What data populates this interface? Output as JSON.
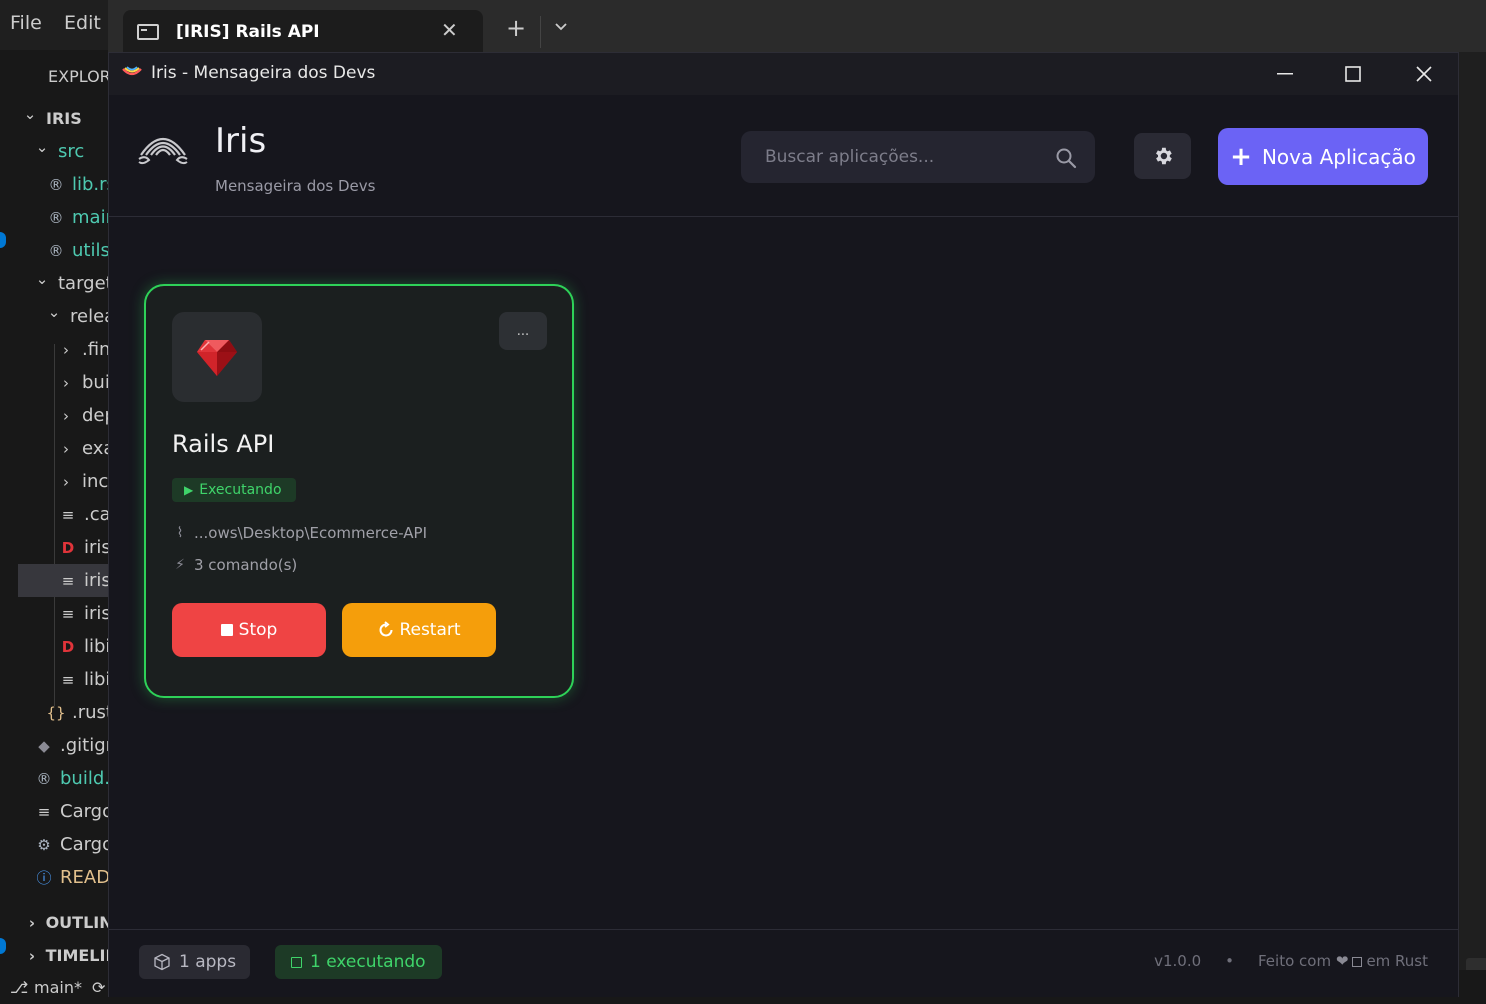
{
  "vscode": {
    "menu": [
      "File",
      "Edit"
    ],
    "explorer_title": "EXPLORER",
    "tree": [
      {
        "label": "IRIS",
        "chevron": "v",
        "indent": 0,
        "bold": true
      },
      {
        "label": "src",
        "chevron": "v",
        "indent": 1,
        "color": "#4ec9b0"
      },
      {
        "label": "lib.rs",
        "icon": "rust-icon",
        "indent": 2,
        "color": "#4ec9b0"
      },
      {
        "label": "main.rs",
        "icon": "rust-icon",
        "indent": 2,
        "color": "#4ec9b0"
      },
      {
        "label": "utils.rs",
        "icon": "rust-icon",
        "indent": 2,
        "color": "#4ec9b0"
      },
      {
        "label": "target",
        "chevron": "v",
        "indent": 1
      },
      {
        "label": "release",
        "chevron": "v",
        "indent": 2
      },
      {
        "label": ".fingerprint",
        "chevron": ">",
        "indent": 3
      },
      {
        "label": "build",
        "chevron": ">",
        "indent": 3
      },
      {
        "label": "deps",
        "chevron": ">",
        "indent": 3
      },
      {
        "label": "examples",
        "chevron": ">",
        "indent": 3
      },
      {
        "label": "incremental",
        "chevron": ">",
        "indent": 3
      },
      {
        "label": ".cargo-lock",
        "icon": "lines-icon",
        "indent": 3
      },
      {
        "label": "iris.d",
        "icon": "d-icon",
        "indent": 3
      },
      {
        "label": "iris.exe",
        "icon": "lines-icon",
        "indent": 3,
        "selected": true
      },
      {
        "label": "iris.pdb",
        "icon": "lines-icon",
        "indent": 3
      },
      {
        "label": "libiris.d",
        "icon": "d-icon",
        "indent": 3
      },
      {
        "label": "libiris.rlib",
        "icon": "lines-icon",
        "indent": 3
      },
      {
        "label": ".rustc_info.json",
        "icon": "braces-icon",
        "indent": 2
      },
      {
        "label": ".gitignore",
        "icon": "git-icon",
        "indent": 1
      },
      {
        "label": "build.rs",
        "icon": "rust-icon",
        "indent": 1,
        "color": "#4ec9b0"
      },
      {
        "label": "Cargo.lock",
        "icon": "lines-icon",
        "indent": 1
      },
      {
        "label": "Cargo.toml",
        "icon": "gear-icon",
        "indent": 1
      },
      {
        "label": "README.md",
        "icon": "info-icon",
        "indent": 1,
        "color": "#e2c08d"
      }
    ],
    "outline": "OUTLINE",
    "timeline": "TIMELINE",
    "branch": "main*"
  },
  "terminal": {
    "tab_title": "[IRIS] Rails API",
    "new_tab": "+",
    "dropdown": "⌄"
  },
  "window": {
    "title": "Iris - Mensageira dos Devs",
    "minimize": "—",
    "maximize": "☐",
    "close": "✕"
  },
  "header": {
    "title": "Iris",
    "subtitle": "Mensageira dos Devs",
    "search_placeholder": "Buscar aplicações...",
    "new_app_label": "Nova Aplicação"
  },
  "apps": [
    {
      "name": "Rails API",
      "status": "Executando",
      "path": "...ows\\Desktop\\Ecommerce-API",
      "commands": "3 comando(s)",
      "more": "...",
      "stop_label": "Stop",
      "restart_label": "Restart"
    }
  ],
  "footer": {
    "apps_count": "1 apps",
    "running": "1 executando",
    "version": "v1.0.0",
    "separator": "•",
    "made_with": "Feito com",
    "in_rust": "em Rust"
  },
  "colors": {
    "accent": "#6b63f5",
    "running_green": "#2ed158",
    "stop_red": "#ef4444",
    "restart_orange": "#f59e0b"
  }
}
